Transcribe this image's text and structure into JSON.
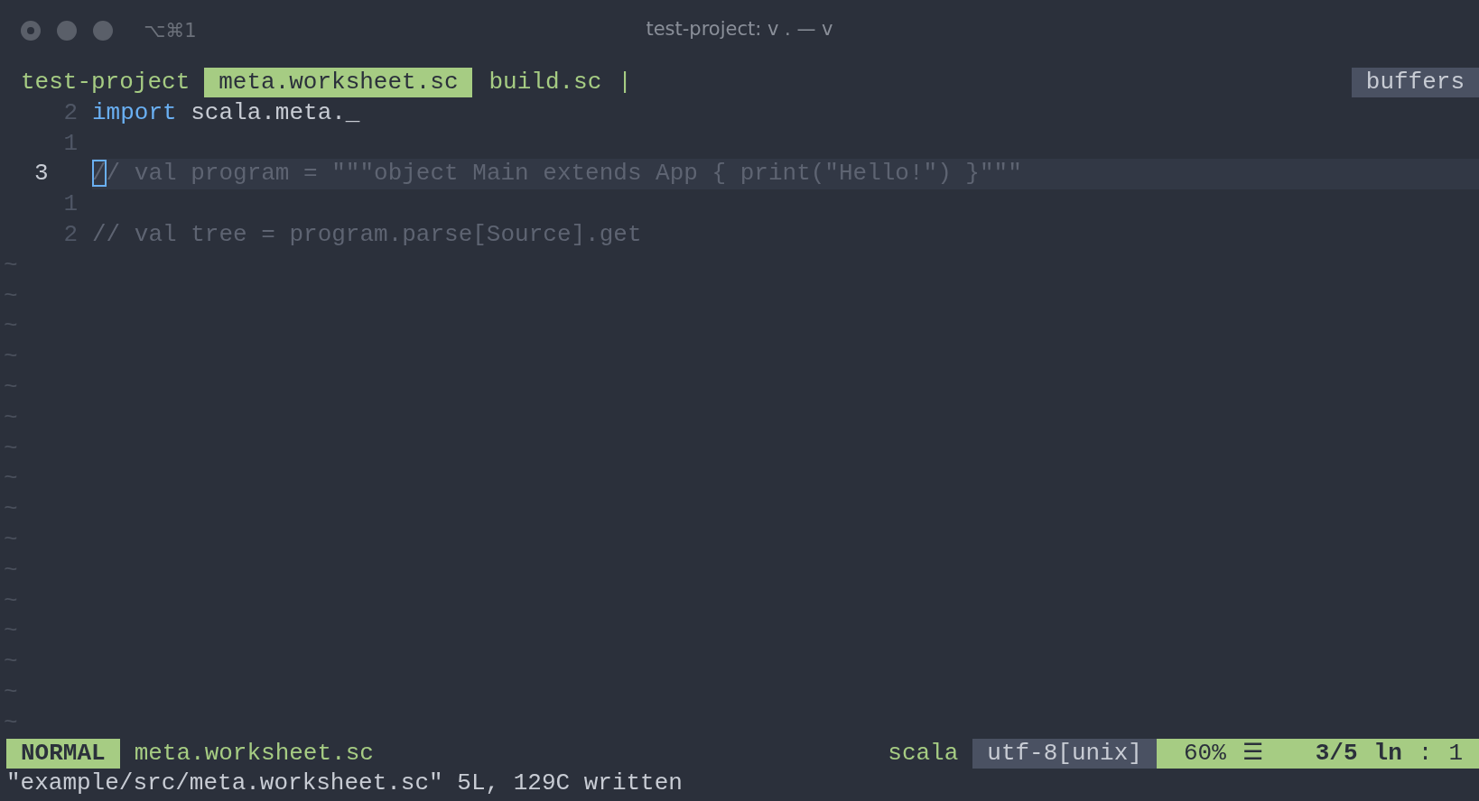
{
  "window": {
    "shortcut": "⌥⌘1",
    "title": "test-project: v . — v"
  },
  "tabline": {
    "project": "test-project",
    "tabs": [
      {
        "label": "meta.worksheet.sc",
        "selected": true
      },
      {
        "label": "build.sc",
        "selected": false
      }
    ],
    "separator": "|",
    "buffers_label": "buffers"
  },
  "editor": {
    "lines": [
      {
        "number": "2",
        "current": false,
        "segments": [
          {
            "kind": "keyword",
            "text": "import"
          },
          {
            "kind": "plain",
            "text": " scala.meta._"
          }
        ]
      },
      {
        "number": "1",
        "current": false
      },
      {
        "number": "3",
        "current": true,
        "cursor": "/",
        "segments": [
          {
            "kind": "comment",
            "text": "/ val program = \"\"\"object Main extends App { print(\"Hello!\") }\"\"\""
          }
        ]
      },
      {
        "number": "1",
        "current": false
      },
      {
        "number": "2",
        "current": false,
        "segments": [
          {
            "kind": "comment",
            "text": "// val tree = program.parse[Source].get"
          }
        ]
      }
    ],
    "filler_lines": [
      "~",
      "~",
      "~",
      "~",
      "~",
      "~",
      "~",
      "~",
      "~",
      "~",
      "~",
      "~",
      "~",
      "~",
      "~",
      "~"
    ]
  },
  "status_bar": {
    "mode": "NORMAL",
    "file": "meta.worksheet.sc",
    "filetype": "scala",
    "encoding": "utf-8[unix]",
    "percent": "60%",
    "menu_glyph": "☰",
    "position": "3/5",
    "line_glyph": "ln",
    "colon": ":",
    "column": "1"
  },
  "message": "\"example/src/meta.worksheet.sc\" 5L, 129C written"
}
